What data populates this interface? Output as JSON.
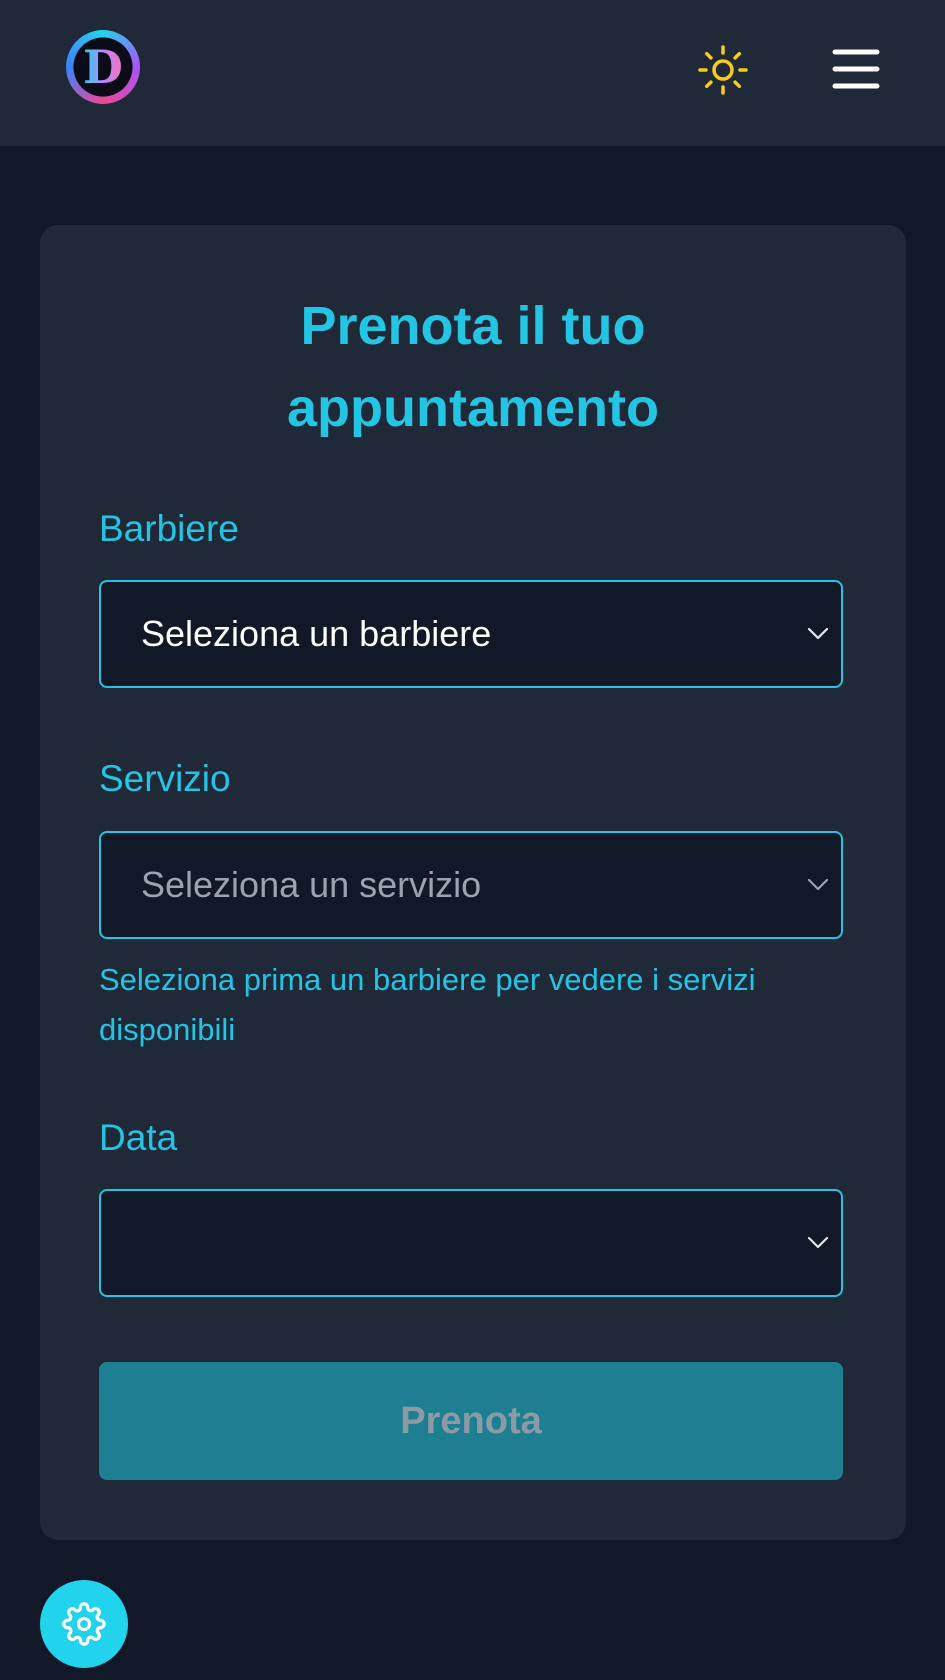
{
  "header": {
    "logo_letter": "D",
    "theme_icon": "sun-icon",
    "menu_icon": "hamburger-menu-icon"
  },
  "form": {
    "title_line1": "Prenota il tuo",
    "title_line2": "appuntamento",
    "barber": {
      "label": "Barbiere",
      "value": "Seleziona un barbiere"
    },
    "service": {
      "label": "Servizio",
      "placeholder": "Seleziona un servizio",
      "hint": "Seleziona prima un barbiere per vedere i servizi disponibili"
    },
    "date": {
      "label": "Data",
      "value": ""
    },
    "submit_label": "Prenota"
  },
  "floating": {
    "settings_icon": "gear-icon"
  },
  "colors": {
    "accent": "#22c5e4",
    "background": "#111827",
    "surface": "#1f2937",
    "button_disabled": "#1f7f92",
    "sun": "#facc15"
  }
}
